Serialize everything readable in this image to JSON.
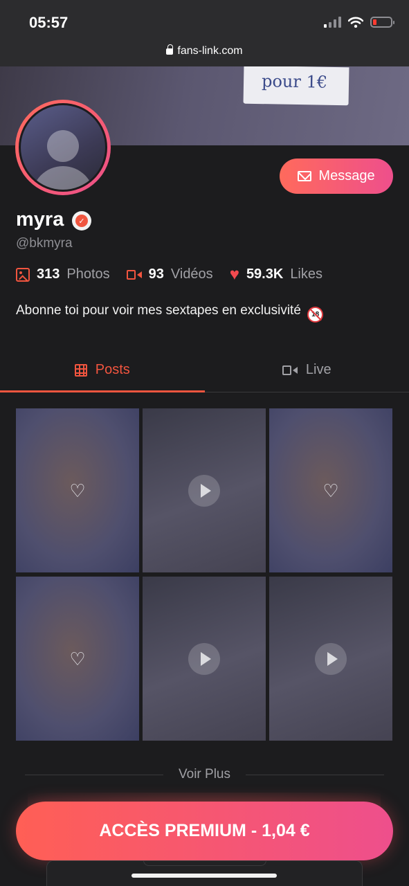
{
  "status_bar": {
    "time": "05:57",
    "icons": [
      "cellular-signal-icon",
      "wifi-icon",
      "battery-low-icon"
    ]
  },
  "browser": {
    "url": "fans-link.com"
  },
  "cover": {
    "note_text": "pour 1€"
  },
  "profile": {
    "name": "myra",
    "handle": "@bkmyra",
    "verified": true,
    "message_label": "Message",
    "bio": "Abonne toi pour voir mes sextapes en exclusivité"
  },
  "stats": {
    "photos": {
      "value": "313",
      "label": "Photos"
    },
    "videos": {
      "value": "93",
      "label": "Vidéos"
    },
    "likes": {
      "value": "59.3K",
      "label": "Likes"
    }
  },
  "tabs": {
    "posts": "Posts",
    "live": "Live",
    "active": "posts"
  },
  "posts": [
    {
      "state": "locked"
    },
    {
      "state": "preview"
    },
    {
      "state": "locked"
    },
    {
      "state": "locked"
    },
    {
      "state": "preview"
    },
    {
      "state": "preview"
    }
  ],
  "see_more": "Voir Plus",
  "premium": {
    "label": "ACCÈS PREMIUM - 1,04 €"
  },
  "colors": {
    "accent": "#f2553f",
    "gradient_start": "#ff6a5c",
    "gradient_end": "#ee4f8c",
    "background": "#1c1c1e"
  }
}
